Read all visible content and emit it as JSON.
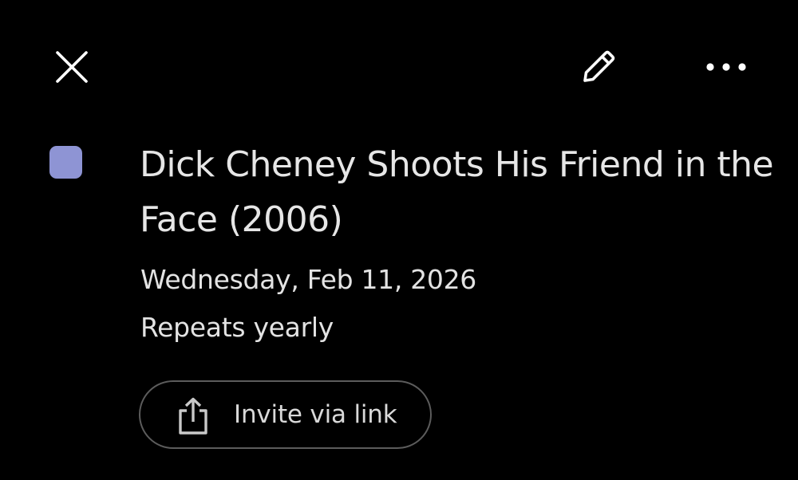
{
  "toolbar": {
    "close_icon": "close-icon",
    "edit_icon": "pencil-icon",
    "more_icon": "more-horizontal-icon"
  },
  "event": {
    "color": "#8e94d4",
    "title": "Dick Cheney Shoots His Friend in the Face (2006)",
    "date": "Wednesday, Feb 11, 2026",
    "repeat": "Repeats yearly"
  },
  "invite": {
    "icon": "share-icon",
    "label": "Invite via link"
  },
  "colors": {
    "background": "#000000",
    "text": "#e3e3e3",
    "outline": "#5c5c5c"
  }
}
